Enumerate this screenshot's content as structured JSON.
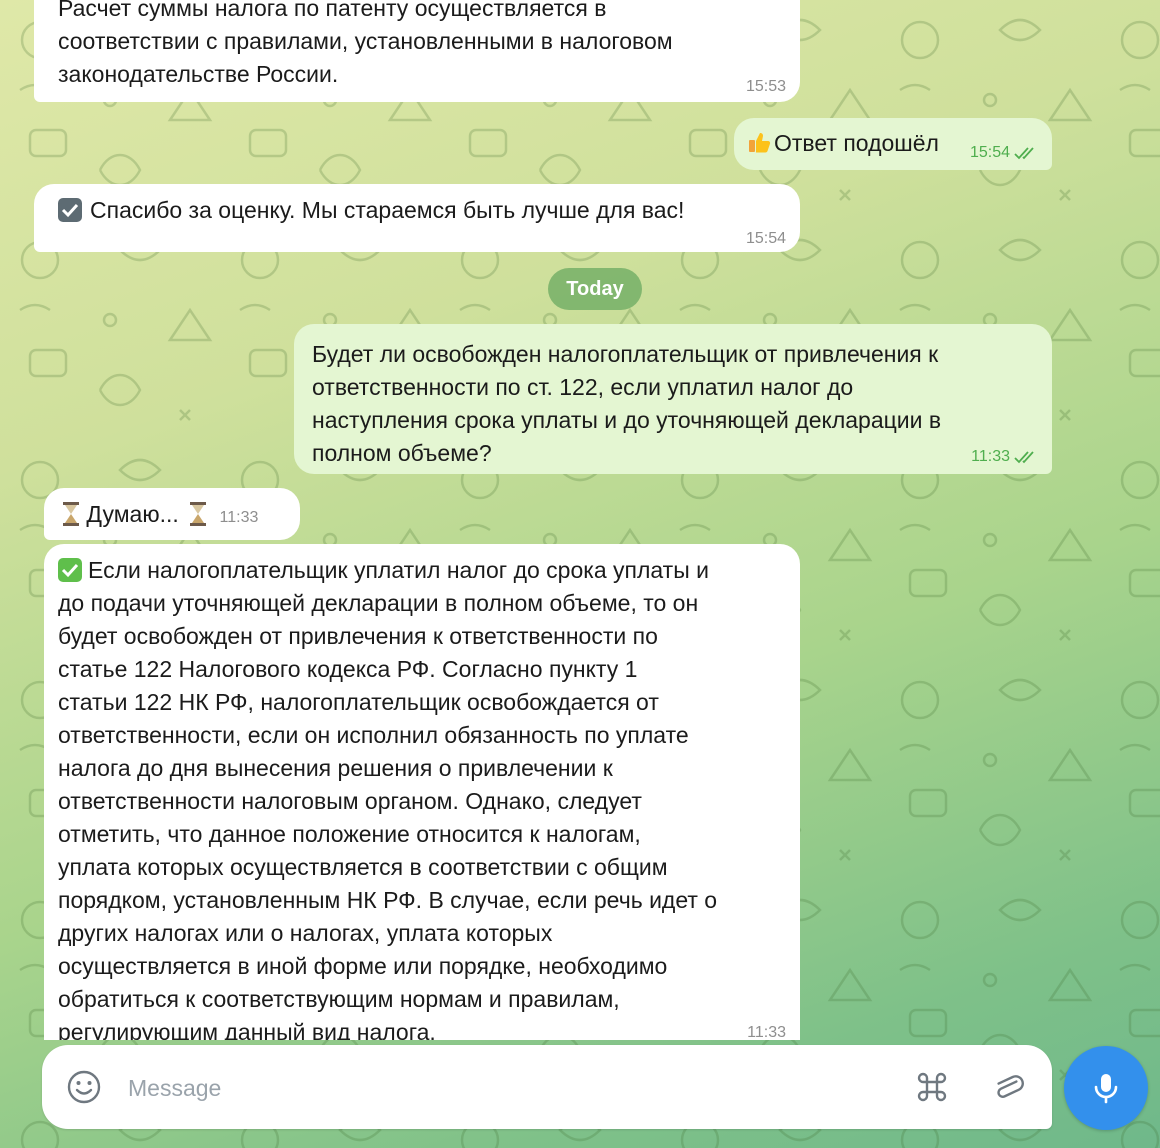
{
  "chat": {
    "messages": [
      {
        "id": "m1",
        "direction": "incoming",
        "lines": [
          "Расчет суммы налога по патенту осуществляется в",
          "соответствии с правилами, установленными в налоговом",
          "законодательстве России."
        ],
        "time": "15:53"
      },
      {
        "id": "m2",
        "direction": "outgoing",
        "emoji": "thumbs-up",
        "text": "Ответ подошёл",
        "time": "15:54",
        "status": "read"
      },
      {
        "id": "m3",
        "direction": "incoming",
        "emoji": "check-box-gray",
        "text": "Спасибо за оценку. Мы стараемся быть лучше для вас!",
        "time": "15:54"
      },
      {
        "id": "m4",
        "direction": "outgoing",
        "lines": [
          "Будет ли освобожден налогоплательщик от привлечения к",
          "ответственности по ст. 122, если уплатил налог до",
          "наступления срока уплаты и до уточняющей декларации в",
          "полном объеме?"
        ],
        "time": "11:33",
        "status": "read"
      },
      {
        "id": "m5",
        "direction": "incoming",
        "emoji": "hourglass",
        "text": "Думаю...",
        "time": "11:33"
      },
      {
        "id": "m6",
        "direction": "incoming",
        "emoji": "check-mark-green",
        "lines": [
          "Если налогоплательщик уплатил налог до срока уплаты и",
          "до подачи уточняющей декларации в полном объеме, то он",
          "будет освобожден от привлечения к ответственности по",
          "статье 122 Налогового кодекса РФ. Согласно пункту 1",
          "статьи 122 НК РФ, налогоплательщик освобождается от",
          "ответственности, если он исполнил обязанность по уплате",
          "налога до дня вынесения решения о привлечении к",
          "ответственности налоговым органом. Однако, следует",
          "отметить, что данное положение относится к налогам,",
          "уплата которых осуществляется в соответствии с общим",
          "порядком, установленным НК РФ. В случае, если речь идет о",
          "других налогах или о налогах, уплата которых",
          "осуществляется в иной форме или порядке, необходимо",
          "обратиться к соответствующим нормам и правилам,",
          "регулирующим данный вид налога."
        ],
        "time": "11:33"
      }
    ],
    "date_separator": "Today"
  },
  "composer": {
    "placeholder": "Message",
    "emoji_icon": "smile-icon",
    "commands_icon": "command-icon",
    "attach_icon": "paperclip-icon",
    "mic_icon": "microphone-icon"
  },
  "colors": {
    "incoming_bubble": "#ffffff",
    "outgoing_bubble": "#e4f6d2",
    "outgoing_time": "#4fae4e",
    "accent": "#3390ec",
    "date_pill": "#6aaa60"
  }
}
